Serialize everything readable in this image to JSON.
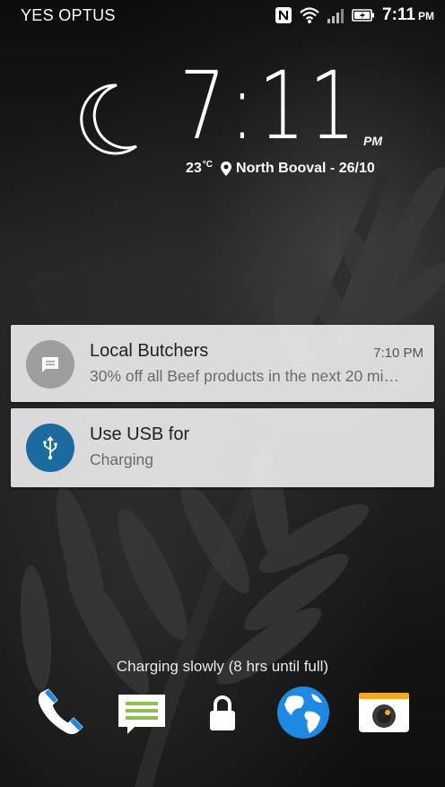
{
  "status_bar": {
    "carrier": "YES OPTUS",
    "time": "7:11",
    "ampm": "PM",
    "icons": [
      "nfc-icon",
      "wifi-icon",
      "signal-icon",
      "battery-charging-icon"
    ]
  },
  "clock_widget": {
    "time": "7:11",
    "ampm": "PM",
    "weather_icon": "moon-icon",
    "temperature": "23",
    "temperature_unit": "°C",
    "location_icon": "location-pin-icon",
    "location_date": "North Booval - 26/10"
  },
  "notifications": [
    {
      "icon": "message-icon",
      "title": "Local Butchers",
      "time": "7:10 PM",
      "text": "30% off all Beef products in the next 20 mi…"
    },
    {
      "icon": "usb-icon",
      "title": "Use USB for",
      "text": "Charging"
    }
  ],
  "charging_status": "Charging slowly (8 hrs until full)",
  "dock": [
    {
      "name": "phone-icon"
    },
    {
      "name": "messages-icon"
    },
    {
      "name": "lock-icon"
    },
    {
      "name": "browser-globe-icon"
    },
    {
      "name": "camera-icon"
    }
  ],
  "colors": {
    "usb_avatar": "#1b6aa0",
    "message_avatar": "#9e9e9e",
    "phone_blue": "#1e88e5",
    "messages_green": "#8bc34a",
    "camera_orange": "#f5a623"
  }
}
